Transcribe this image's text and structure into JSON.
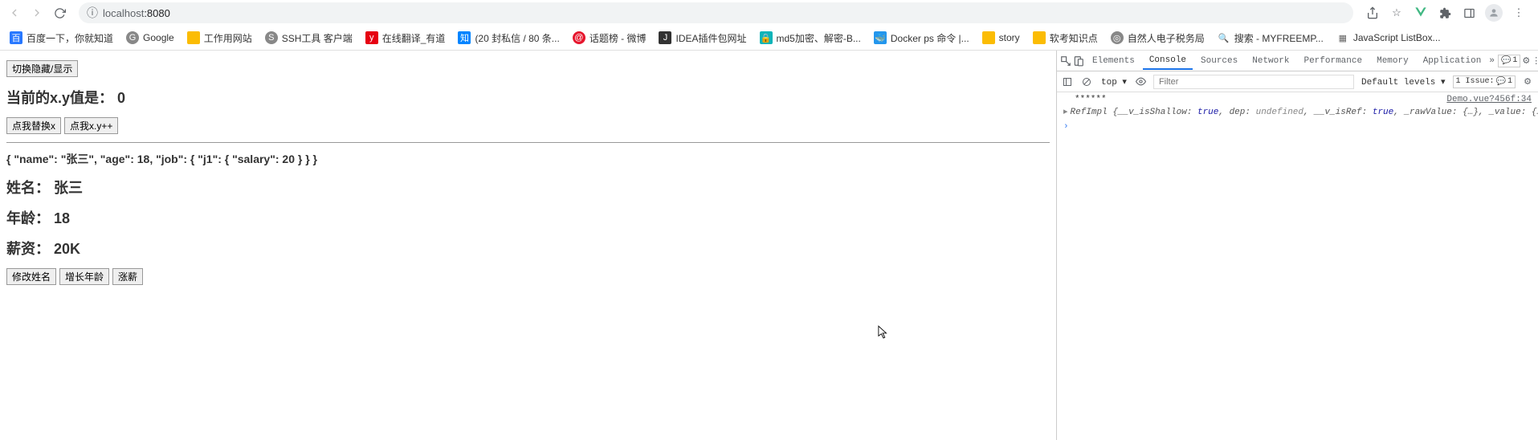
{
  "browser": {
    "url_host": "localhost",
    "url_port": ":8080"
  },
  "bookmarks": [
    {
      "label": "百度一下，你就知道",
      "icon_class": "blue",
      "icon_text": "百"
    },
    {
      "label": "Google",
      "icon_class": "gray",
      "icon_text": "G"
    },
    {
      "label": "工作用网站",
      "icon_class": "yellow",
      "icon_text": ""
    },
    {
      "label": "SSH工具 客户端",
      "icon_class": "gray",
      "icon_text": "S"
    },
    {
      "label": "在线翻译_有道",
      "icon_class": "yd",
      "icon_text": "y"
    },
    {
      "label": "(20 封私信 / 80 条...",
      "icon_class": "zhi",
      "icon_text": "知"
    },
    {
      "label": "话题榜 - 微博",
      "icon_class": "wb",
      "icon_text": "@"
    },
    {
      "label": "IDEA插件包网址",
      "icon_class": "dark",
      "icon_text": "J"
    },
    {
      "label": "md5加密、解密-B...",
      "icon_class": "teal",
      "icon_text": "🔒"
    },
    {
      "label": "Docker ps 命令 |...",
      "icon_class": "docker",
      "icon_text": "🐳"
    },
    {
      "label": "story",
      "icon_class": "yellow",
      "icon_text": ""
    },
    {
      "label": "软考知识点",
      "icon_class": "yellow",
      "icon_text": ""
    },
    {
      "label": "自然人电子税务局",
      "icon_class": "gray",
      "icon_text": "◎"
    },
    {
      "label": "搜索 - MYFREEMP...",
      "icon_class": "plain",
      "icon_text": "🔍"
    },
    {
      "label": "JavaScript ListBox...",
      "icon_class": "plain",
      "icon_text": "▦"
    }
  ],
  "page": {
    "toggle_btn": "切换隐藏/显示",
    "xy_label": "当前的x.y值是：",
    "xy_value": "0",
    "replace_btn": "点我替换x",
    "inc_btn": "点我x.y++",
    "json_line": "{ \"name\": \"张三\", \"age\": 18, \"job\": { \"j1\": { \"salary\": 20 } } }",
    "name_label": "姓名：",
    "name_value": "张三",
    "age_label": "年龄：",
    "age_value": "18",
    "salary_label": "薪资：",
    "salary_value": "20K",
    "mod_name_btn": "修改姓名",
    "inc_age_btn": "增长年龄",
    "raise_btn": "涨薪"
  },
  "devtools": {
    "tabs": {
      "elements": "Elements",
      "console": "Console",
      "sources": "Sources",
      "network": "Network",
      "performance": "Performance",
      "memory": "Memory",
      "application": "Application"
    },
    "badge_count": "1",
    "filter_top": "top ▾",
    "filter_placeholder": "Filter",
    "default_levels": "Default levels ▾",
    "issue_text": "1 Issue:",
    "issue_badge": "1",
    "log1": "******",
    "log1_link": "Demo.vue?456f:34",
    "log2_prefix": "▸ ",
    "log2_type": "RefImpl",
    "log2_body": " {__v_isShallow: ",
    "log2_true1": "true",
    "log2_mid1": ", dep: ",
    "log2_undef": "undefined",
    "log2_mid2": ", __v_isRef: ",
    "log2_true2": "true",
    "log2_mid3": ", _rawValue: ",
    "log2_obj1": "{…}",
    "log2_mid4": ", _value: ",
    "log2_obj2": "{…}",
    "log2_end": "}"
  }
}
